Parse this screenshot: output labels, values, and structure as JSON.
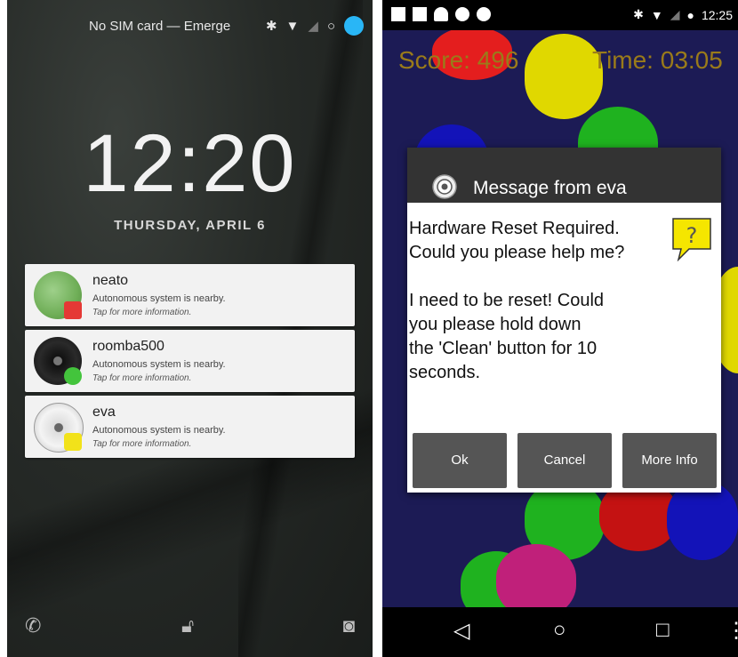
{
  "lock_screen": {
    "status": {
      "carrier": "No SIM card — Emerge"
    },
    "clock": "12:20",
    "date": "THURSDAY, APRIL 6",
    "notifications": [
      {
        "title": "neato",
        "text": "Autonomous system is nearby.",
        "sub": "Tap for more information.",
        "badge_color": "#e53935"
      },
      {
        "title": "roomba500",
        "text": "Autonomous system is nearby.",
        "sub": "Tap for more information.",
        "badge_color": "#43c43c"
      },
      {
        "title": "eva",
        "text": "Autonomous system is nearby.",
        "sub": "Tap for more information.",
        "badge_color": "#f2e21a"
      }
    ],
    "bottom_icons": [
      "phone-icon",
      "lock-icon",
      "camera-icon"
    ]
  },
  "game_screen": {
    "status": {
      "time": "12:25"
    },
    "score": "Score: 496",
    "timer": "Time: 03:05",
    "dialog": {
      "title": "Message from eva",
      "message": "Hardware Reset Required.\nCould you please help me?\n\nI need to be reset! Could\nyou please hold down\nthe 'Clean' button for 10\nseconds.",
      "buttons": {
        "ok": "Ok",
        "cancel": "Cancel",
        "more": "More Info"
      }
    },
    "nav": [
      "back-icon",
      "home-icon",
      "recents-icon",
      "overflow-icon"
    ]
  }
}
